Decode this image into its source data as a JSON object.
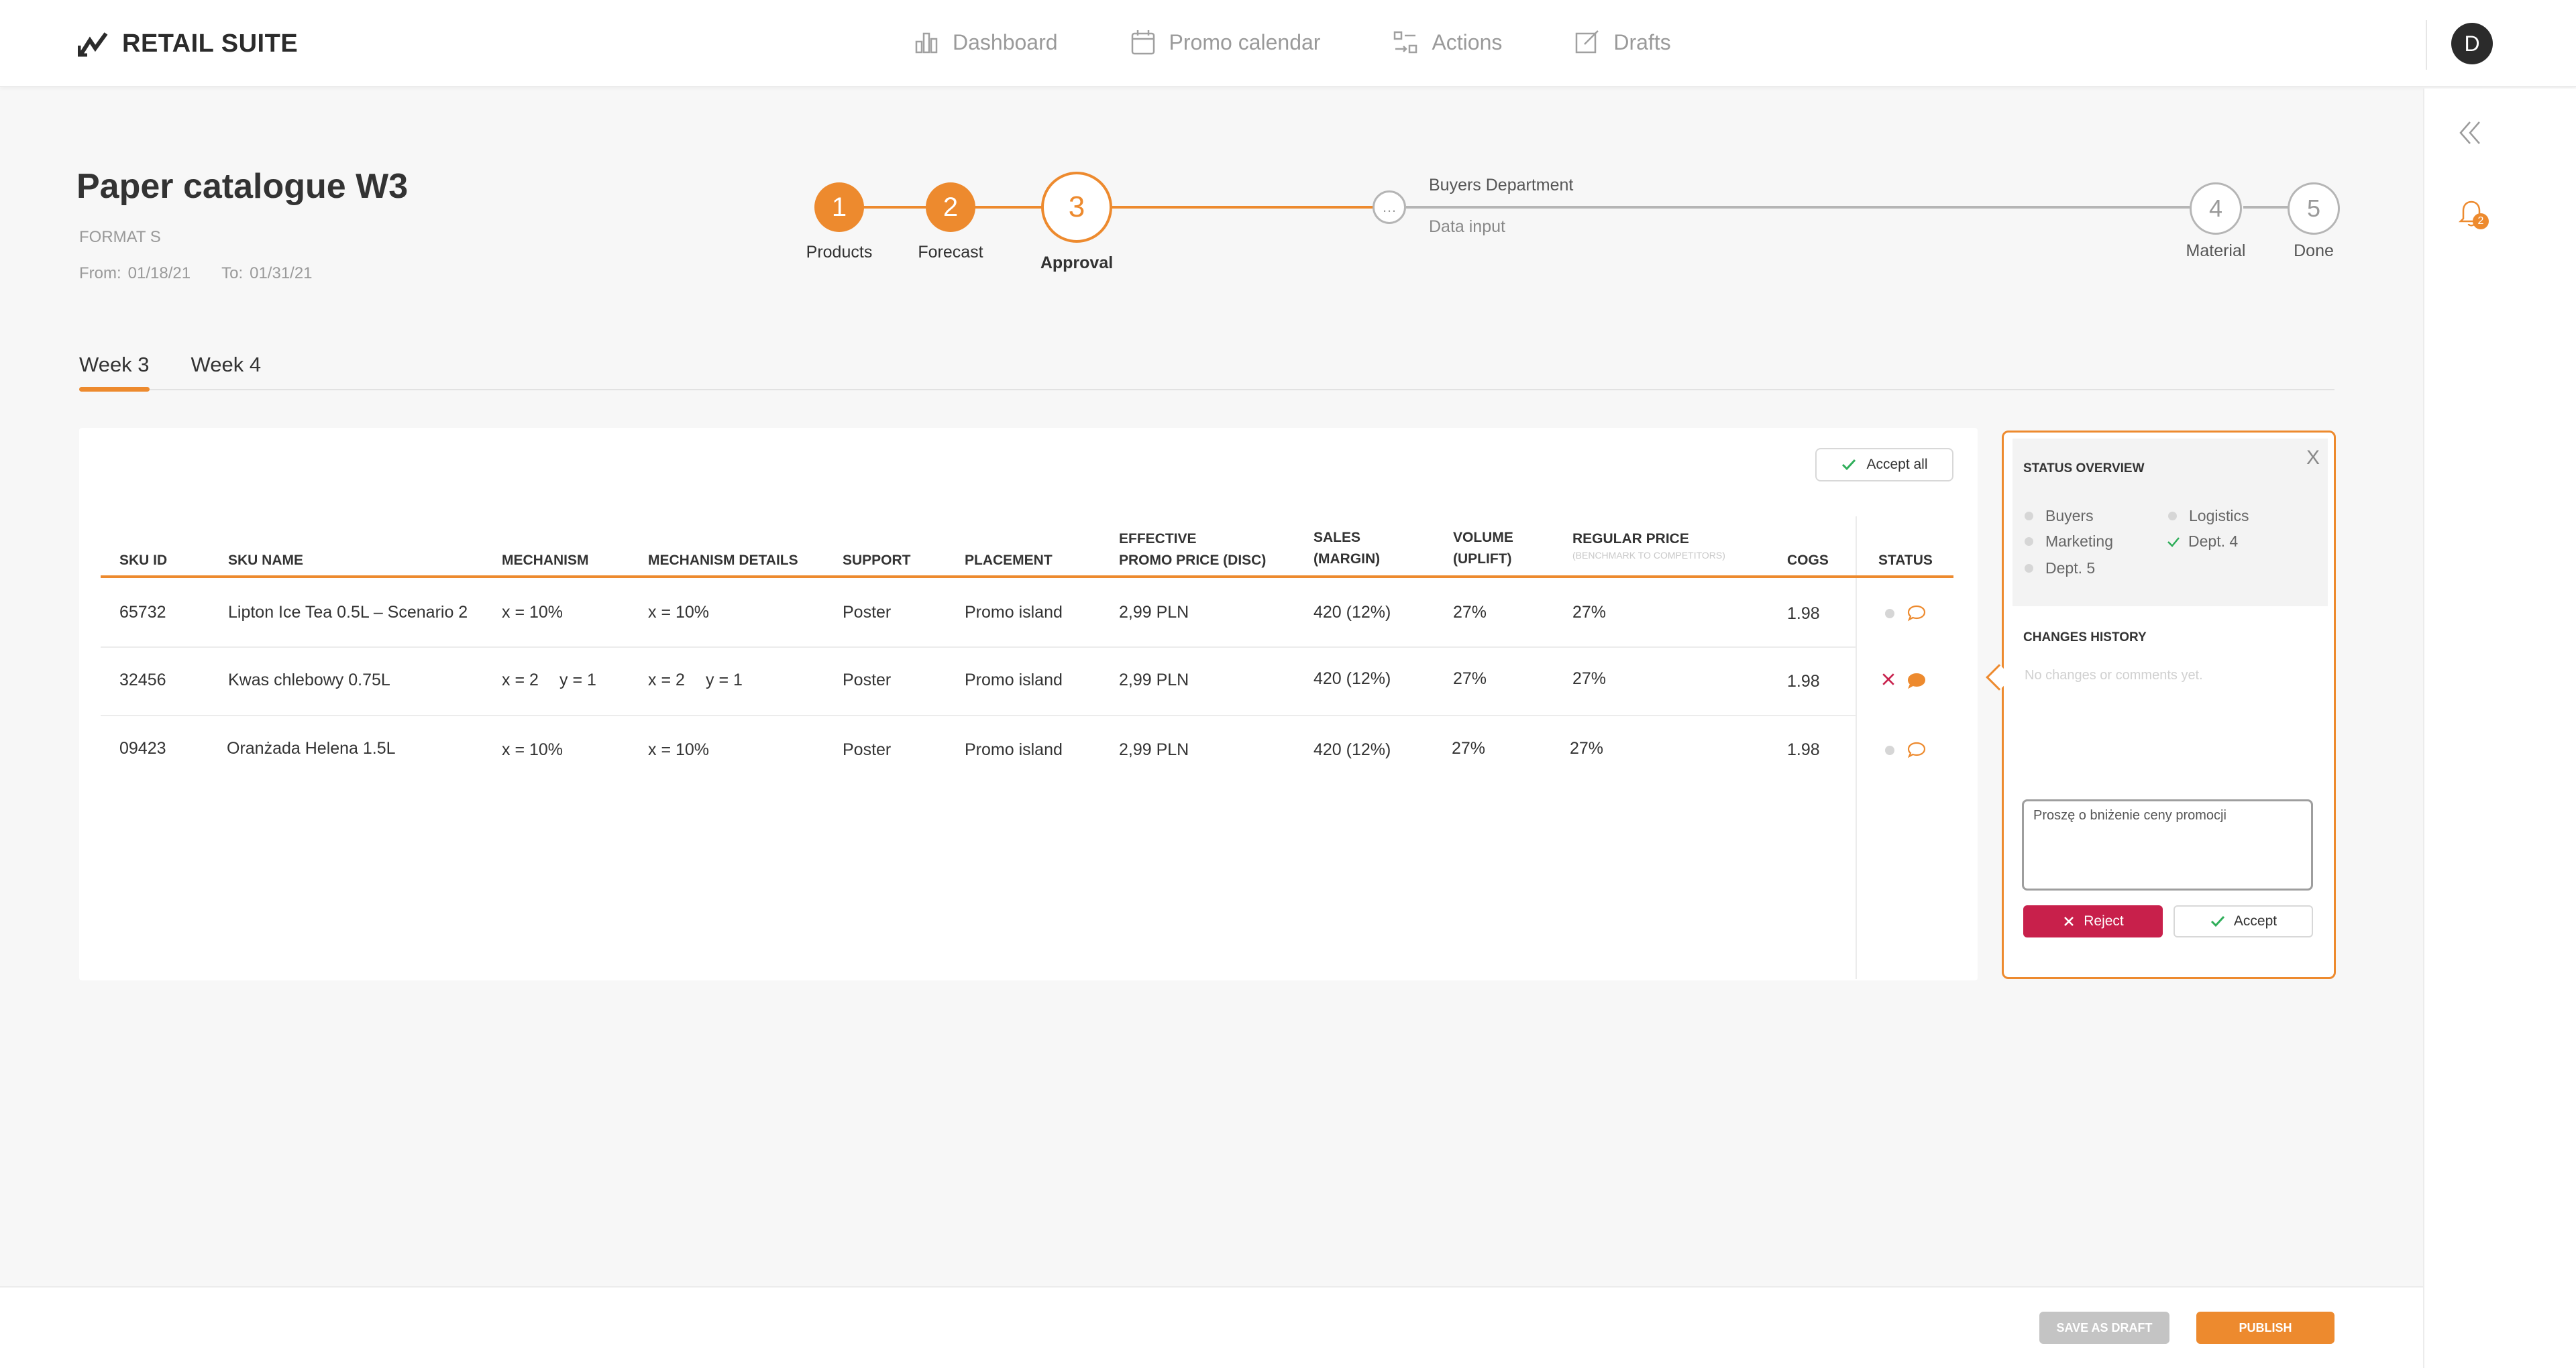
{
  "app": {
    "name": "RETAIL SUITE",
    "avatar_initial": "D"
  },
  "nav": {
    "items": [
      {
        "label": "Dashboard",
        "icon": "bar-chart-icon"
      },
      {
        "label": "Promo calendar",
        "icon": "calendar-icon"
      },
      {
        "label": "Actions",
        "icon": "actions-icon"
      },
      {
        "label": "Drafts",
        "icon": "edit-icon"
      }
    ]
  },
  "rail": {
    "notification_count": "2"
  },
  "header": {
    "title": "Paper catalogue W3",
    "format": "FORMAT S",
    "from_label": "From:",
    "from_value": "01/18/21",
    "to_label": "To:",
    "to_value": "01/31/21"
  },
  "stepper": {
    "steps": [
      {
        "number": "1",
        "label": "Products",
        "state": "done"
      },
      {
        "number": "2",
        "label": "Forecast",
        "state": "done"
      },
      {
        "number": "3",
        "label": "Approval",
        "state": "active"
      },
      {
        "number": "…",
        "label": "Buyers Department",
        "sublabel": "Data input",
        "state": "pending"
      },
      {
        "number": "4",
        "label": "Material",
        "state": "pending"
      },
      {
        "number": "5",
        "label": "Done",
        "state": "pending"
      }
    ],
    "accent_color": "#ed8a2e"
  },
  "tabs": [
    {
      "label": "Week 3",
      "active": true
    },
    {
      "label": "Week 4",
      "active": false
    }
  ],
  "table": {
    "accept_all_label": "Accept all",
    "headers": {
      "sku_id": "SKU ID",
      "sku_name": "SKU NAME",
      "mechanism": "MECHANISM",
      "mechanism_details": "MECHANISM DETAILS",
      "support": "SUPPORT",
      "placement": "PLACEMENT",
      "effective_1": "EFFECTIVE",
      "effective_2": "PROMO PRICE (DISC)",
      "sales_1": "SALES",
      "sales_2": "(MARGIN)",
      "volume_1": "VOLUME",
      "volume_2": "(UPLIFT)",
      "regular_1": "REGULAR PRICE",
      "regular_2": "(BENCHMARK TO COMPETITORS)",
      "cogs": "COGS",
      "status": "STATUS"
    },
    "rows": [
      {
        "sku_id": "65732",
        "sku_name": "Lipton Ice Tea 0.5L – Scenario 2",
        "mechanism": "x = 10%",
        "mechanism_details": "x = 10%",
        "support": "Poster",
        "placement": "Promo island",
        "promo_price": "2,99 PLN",
        "sales": "420 (12%)",
        "volume": "27%",
        "regular_price": "27%",
        "cogs": "1.98",
        "status": "pending",
        "comment": "outline"
      },
      {
        "sku_id": "32456",
        "sku_name": "Kwas chlebowy 0.75L",
        "mechanism_a": "x = 2",
        "mechanism_b": "y = 1",
        "details_a": "x = 2",
        "details_b": "y = 1",
        "support": "Poster",
        "placement": "Promo island",
        "promo_price": "2,99 PLN",
        "sales": "420 (12%)",
        "volume": "27%",
        "regular_price": "27%",
        "cogs": "1.98",
        "status": "rejected",
        "comment": "filled"
      },
      {
        "sku_id": "09423",
        "sku_name": "Oranżada Helena 1.5L",
        "mechanism": "x = 10%",
        "mechanism_details": "x = 10%",
        "support": "Poster",
        "placement": "Promo island",
        "promo_price": "2,99 PLN",
        "sales": "420 (12%)",
        "volume": "27%",
        "regular_price": "27%",
        "cogs": "1.98",
        "status": "pending",
        "comment": "outline"
      }
    ]
  },
  "panel": {
    "close_label": "X",
    "overview_title": "STATUS OVERVIEW",
    "departments": [
      {
        "label": "Buyers",
        "state": "pending"
      },
      {
        "label": "Logistics",
        "state": "pending"
      },
      {
        "label": "Marketing",
        "state": "pending"
      },
      {
        "label": "Dept. 4",
        "state": "accepted"
      },
      {
        "label": "Dept. 5",
        "state": "pending"
      }
    ],
    "history_title": "CHANGES HISTORY",
    "no_changes": "No changes or comments yet.",
    "comment_value": "Proszę o bniżenie ceny promocji",
    "reject_label": "Reject",
    "accept_label": "Accept"
  },
  "footer": {
    "save_draft_label": "SAVE AS DRAFT",
    "publish_label": "PUBLISH"
  },
  "colors": {
    "accent": "#ed8a2e",
    "reject": "#c8204b",
    "accept_check": "#2fae5a"
  }
}
